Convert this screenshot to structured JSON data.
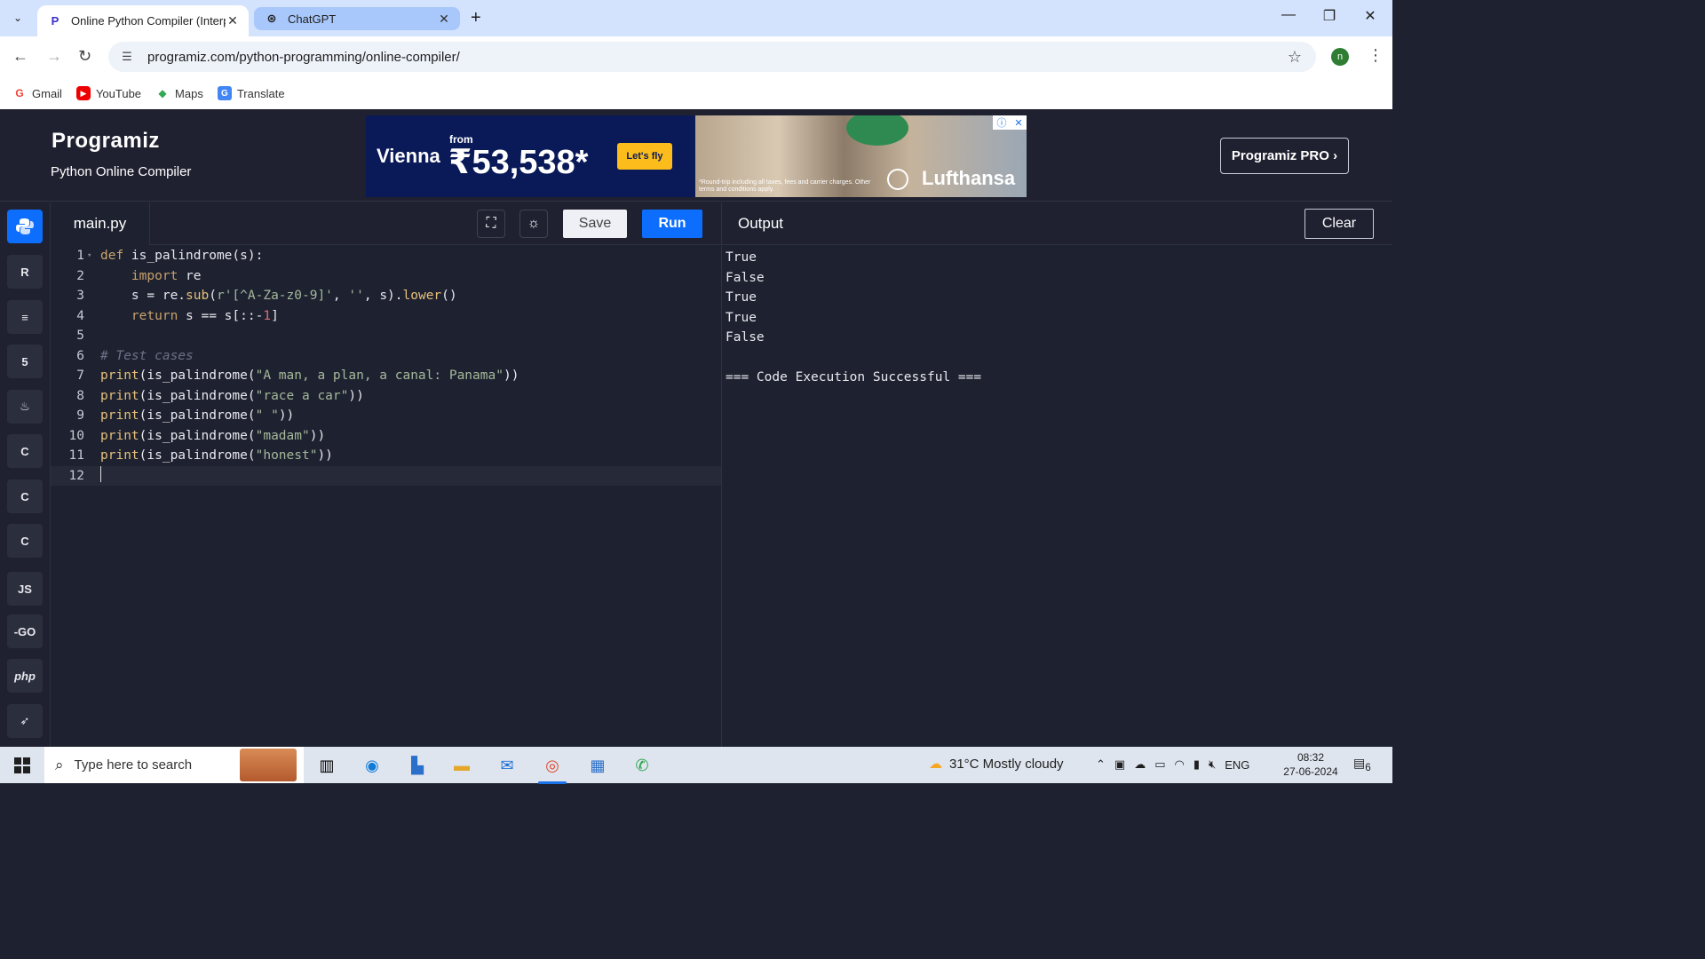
{
  "browser": {
    "tabs": [
      {
        "title": "Online Python Compiler (Interp",
        "favicon": "programiz-icon",
        "active": true
      },
      {
        "title": "ChatGPT",
        "favicon": "chatgpt-icon",
        "active": false
      }
    ],
    "url": "programiz.com/python-programming/online-compiler/",
    "profile_initial": "n",
    "bookmarks": [
      {
        "label": "Gmail",
        "icon": "gmail-icon"
      },
      {
        "label": "YouTube",
        "icon": "youtube-icon"
      },
      {
        "label": "Maps",
        "icon": "maps-icon"
      },
      {
        "label": "Translate",
        "icon": "translate-icon"
      }
    ]
  },
  "header": {
    "logo": "Programiz",
    "subtitle": "Python Online Compiler",
    "pro_button": "Programiz PRO ›"
  },
  "ad": {
    "city": "Vienna",
    "from": "from",
    "price": "₹53,538*",
    "cta": "Let's fly",
    "brand": "Lufthansa",
    "fine_print": "*Round-trip including all taxes, fees and carrier charges. Other terms and conditions apply."
  },
  "sidebar": {
    "languages": [
      {
        "name": "python-icon",
        "label": "",
        "active": true
      },
      {
        "name": "r-icon",
        "label": "R",
        "active": false
      },
      {
        "name": "sql-icon",
        "label": "≡",
        "active": false
      },
      {
        "name": "html-icon",
        "label": "5",
        "active": false
      },
      {
        "name": "java-icon",
        "label": "♨",
        "active": false
      },
      {
        "name": "c-icon",
        "label": "C",
        "active": false
      },
      {
        "name": "cpp-icon",
        "label": "C",
        "active": false
      },
      {
        "name": "csharp-icon",
        "label": "C",
        "active": false
      },
      {
        "name": "js-icon",
        "label": "JS",
        "active": false
      },
      {
        "name": "go-icon",
        "label": "-GO",
        "active": false
      },
      {
        "name": "php-icon",
        "label": "php",
        "active": false
      },
      {
        "name": "swift-icon",
        "label": "➶",
        "active": false
      }
    ]
  },
  "editor": {
    "filename": "main.py",
    "save_label": "Save",
    "run_label": "Run",
    "lines": [
      [
        {
          "t": "kw",
          "v": "def "
        },
        {
          "t": "code",
          "v": "is_palindrome(s):"
        }
      ],
      [
        {
          "t": "code",
          "v": "    "
        },
        {
          "t": "kw",
          "v": "import "
        },
        {
          "t": "code",
          "v": "re"
        }
      ],
      [
        {
          "t": "code",
          "v": "    s = re."
        },
        {
          "t": "fn",
          "v": "sub"
        },
        {
          "t": "code",
          "v": "("
        },
        {
          "t": "str",
          "v": "r'[^A-Za-z0-9]'"
        },
        {
          "t": "code",
          "v": ", "
        },
        {
          "t": "str",
          "v": "''"
        },
        {
          "t": "code",
          "v": ", s)."
        },
        {
          "t": "fn",
          "v": "lower"
        },
        {
          "t": "code",
          "v": "()"
        }
      ],
      [
        {
          "t": "code",
          "v": "    "
        },
        {
          "t": "kw",
          "v": "return "
        },
        {
          "t": "code",
          "v": "s == s[::-"
        },
        {
          "t": "num",
          "v": "1"
        },
        {
          "t": "code",
          "v": "]"
        }
      ],
      [],
      [
        {
          "t": "cm",
          "v": "# Test cases"
        }
      ],
      [
        {
          "t": "fn",
          "v": "print"
        },
        {
          "t": "code",
          "v": "(is_palindrome("
        },
        {
          "t": "str",
          "v": "\"A man, a plan, a canal: Panama\""
        },
        {
          "t": "code",
          "v": "))"
        }
      ],
      [
        {
          "t": "fn",
          "v": "print"
        },
        {
          "t": "code",
          "v": "(is_palindrome("
        },
        {
          "t": "str",
          "v": "\"race a car\""
        },
        {
          "t": "code",
          "v": "))"
        }
      ],
      [
        {
          "t": "fn",
          "v": "print"
        },
        {
          "t": "code",
          "v": "(is_palindrome("
        },
        {
          "t": "str",
          "v": "\" \""
        },
        {
          "t": "code",
          "v": "))"
        }
      ],
      [
        {
          "t": "fn",
          "v": "print"
        },
        {
          "t": "code",
          "v": "(is_palindrome("
        },
        {
          "t": "str",
          "v": "\"madam\""
        },
        {
          "t": "code",
          "v": "))"
        }
      ],
      [
        {
          "t": "fn",
          "v": "print"
        },
        {
          "t": "code",
          "v": "(is_palindrome("
        },
        {
          "t": "str",
          "v": "\"honest\""
        },
        {
          "t": "code",
          "v": "))"
        }
      ],
      []
    ]
  },
  "output": {
    "title": "Output",
    "clear_label": "Clear",
    "lines": [
      "True",
      "False",
      "True",
      "True",
      "False",
      "",
      "=== Code Execution Successful ==="
    ]
  },
  "taskbar": {
    "search_placeholder": "Type here to search",
    "weather": "31°C  Mostly cloudy",
    "language": "ENG",
    "time": "08:32",
    "date": "27-06-2024",
    "notifications": "6"
  }
}
